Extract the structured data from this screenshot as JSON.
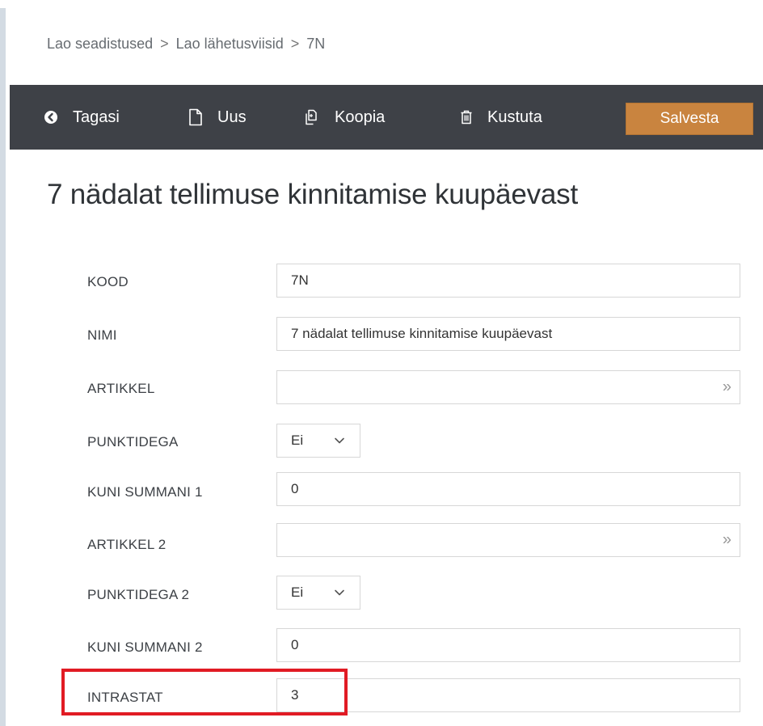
{
  "breadcrumb": {
    "items": [
      "Lao seadistused",
      "Lao lähetusviisid",
      "7N"
    ],
    "separator": ">"
  },
  "toolbar": {
    "back_label": "Tagasi",
    "new_label": "Uus",
    "copy_label": "Koopia",
    "delete_label": "Kustuta",
    "save_label": "Salvesta",
    "back_icon": "circle-arrow-left-icon",
    "new_icon": "document-icon",
    "copy_icon": "copy-icon",
    "delete_icon": "trash-icon",
    "background_color": "#3e4147",
    "save_color": "#c9843f"
  },
  "page": {
    "title": "7 nädalat tellimuse kinnitamise kuupäevast"
  },
  "form": {
    "rows": [
      {
        "label": "KOOD",
        "type": "text",
        "value": "7N"
      },
      {
        "label": "NIMI",
        "type": "text",
        "value": "7 nädalat tellimuse kinnitamise kuupäevast"
      },
      {
        "label": "ARTIKKEL",
        "type": "lookup",
        "value": ""
      },
      {
        "label": "PUNKTIDEGA",
        "type": "select",
        "value": "Ei"
      },
      {
        "label": "KUNI SUMMANI 1",
        "type": "text",
        "value": "0"
      },
      {
        "label": "ARTIKKEL 2",
        "type": "lookup",
        "value": ""
      },
      {
        "label": "PUNKTIDEGA 2",
        "type": "select",
        "value": "Ei"
      },
      {
        "label": "KUNI SUMMANI 2",
        "type": "text",
        "value": "0"
      },
      {
        "label": "INTRASTAT",
        "type": "text",
        "value": "3"
      }
    ],
    "lookup_icon": "double-chevron-right-icon",
    "lookup_glyph": "»",
    "select_icon": "chevron-down-icon"
  },
  "highlight": {
    "target": "INTRASTAT",
    "color": "#e11b24"
  }
}
